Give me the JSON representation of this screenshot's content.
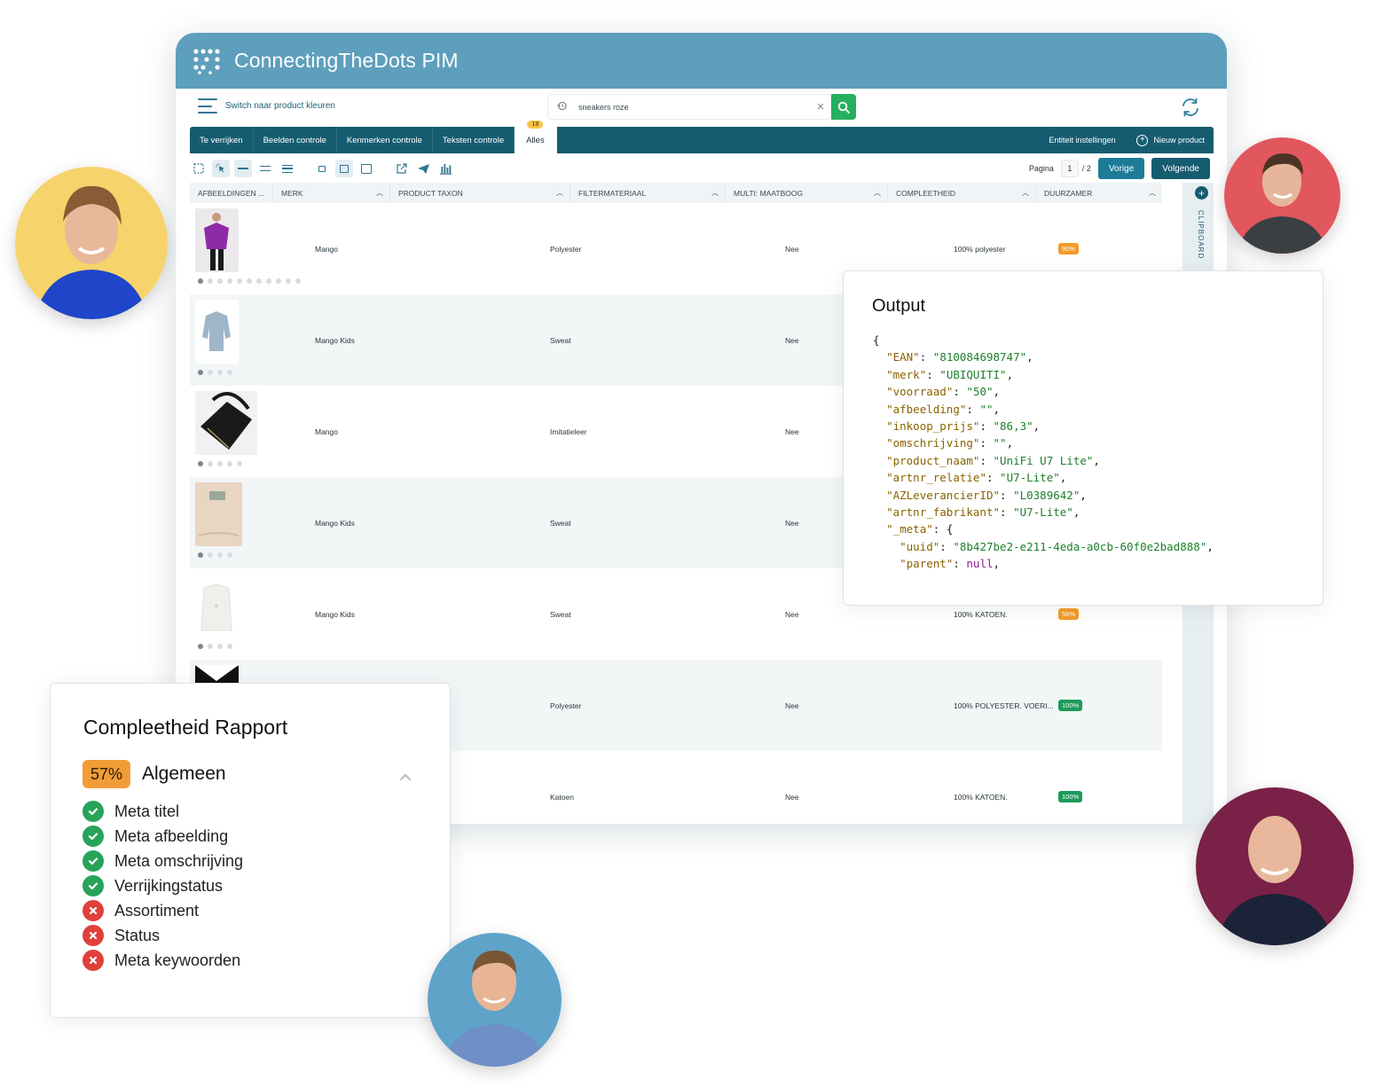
{
  "app": {
    "title": "ConnectingTheDots PIM",
    "switch_label": "Switch naar product kleuren",
    "search_value": "sneakers roze",
    "brand_color": "#5e9fbd",
    "nav_color": "#165c71"
  },
  "tabs": [
    {
      "label": "Te verrijken"
    },
    {
      "label": "Beelden controle"
    },
    {
      "label": "Kenmerken controle"
    },
    {
      "label": "Teksten controle"
    },
    {
      "label": "Alles",
      "badge": "19"
    }
  ],
  "tab_actions": {
    "settings": "Entiteit instellingen",
    "new_product": "Nieuw product"
  },
  "pager": {
    "label": "Pagina",
    "current": "1",
    "total": "/ 2",
    "prev": "Vorige",
    "next": "Volgende"
  },
  "columns": [
    {
      "label": "AFBEELDINGEN ..."
    },
    {
      "label": "MERK"
    },
    {
      "label": "PRODUCT TAXON"
    },
    {
      "label": "FILTERMATERIAAL"
    },
    {
      "label": "MULTI: MAATBOOG"
    },
    {
      "label": "COMPLEETHEID"
    },
    {
      "label": "DUURZAMER"
    }
  ],
  "rows": [
    {
      "merk": "Mango",
      "materiaal": "Polyester",
      "maatboog": "Nee",
      "compleetheid": "100% polyester",
      "pct": "90%",
      "pct_status": "orange"
    },
    {
      "merk": "Mango Kids",
      "materiaal": "Sweat",
      "maatboog": "Nee",
      "compleetheid": "",
      "pct": "",
      "pct_status": ""
    },
    {
      "merk": "Mango",
      "materiaal": "Imitatieleer",
      "maatboog": "Nee",
      "compleetheid": "",
      "pct": "",
      "pct_status": ""
    },
    {
      "merk": "Mango Kids",
      "materiaal": "Sweat",
      "maatboog": "Nee",
      "compleetheid": "",
      "pct": "",
      "pct_status": ""
    },
    {
      "merk": "Mango Kids",
      "materiaal": "Sweat",
      "maatboog": "Nee",
      "compleetheid": "100% KATOEN.",
      "pct": "56%",
      "pct_status": "orange"
    },
    {
      "merk": "",
      "materiaal": "Polyester",
      "maatboog": "Nee",
      "compleetheid": "100% POLYESTER. VOERI...",
      "pct": "100%",
      "pct_status": "green"
    },
    {
      "merk": "",
      "materiaal": "Katoen",
      "maatboog": "Nee",
      "compleetheid": "100% KATOEN.",
      "pct": "100%",
      "pct_status": "green"
    }
  ],
  "clipboard": {
    "label": "CLIPBOARD"
  },
  "output": {
    "title": "Output",
    "json": [
      {
        "key": "EAN",
        "value": "810084698747"
      },
      {
        "key": "merk",
        "value": "UBIQUITI"
      },
      {
        "key": "voorraad",
        "value": "50"
      },
      {
        "key": "afbeelding",
        "value": ""
      },
      {
        "key": "inkoop_prijs",
        "value": "86,3"
      },
      {
        "key": "omschrijving",
        "value": ""
      },
      {
        "key": "product_naam",
        "value": "UniFi U7 Lite"
      },
      {
        "key": "artnr_relatie",
        "value": "U7-Lite"
      },
      {
        "key": "AZLeverancierID",
        "value": "L0389642"
      },
      {
        "key": "artnr_fabrikant",
        "value": "U7-Lite"
      }
    ],
    "meta_key": "_meta",
    "meta": [
      {
        "key": "uuid",
        "value": "8b427be2-e211-4eda-a0cb-60f0e2bad888"
      },
      {
        "key": "parent",
        "value": "null"
      }
    ]
  },
  "report": {
    "title": "Compleetheid Rapport",
    "pct": "57%",
    "category": "Algemeen",
    "items": [
      {
        "label": "Meta titel",
        "ok": true
      },
      {
        "label": "Meta afbeelding",
        "ok": true
      },
      {
        "label": "Meta omschrijving",
        "ok": true
      },
      {
        "label": "Verrijkingstatus",
        "ok": true
      },
      {
        "label": "Assortiment",
        "ok": false
      },
      {
        "label": "Status",
        "ok": false
      },
      {
        "label": "Meta keywoorden",
        "ok": false
      }
    ]
  }
}
